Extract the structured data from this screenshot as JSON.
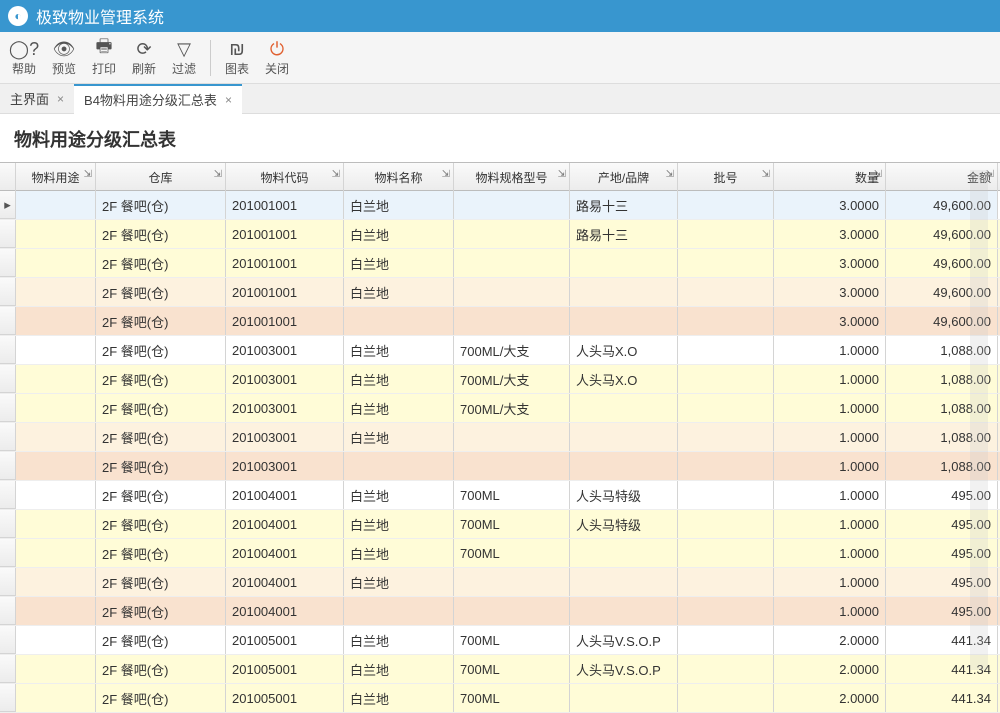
{
  "app": {
    "title": "极致物业管理系统"
  },
  "toolbar": {
    "help": "帮助",
    "preview": "预览",
    "print": "打印",
    "refresh": "刷新",
    "filter": "过滤",
    "chart": "图表",
    "close": "关闭"
  },
  "tabs": [
    {
      "label": "主界面",
      "closable": true,
      "active": false
    },
    {
      "label": "B4物料用途分级汇总表",
      "closable": true,
      "active": true
    }
  ],
  "page": {
    "title": "物料用途分级汇总表"
  },
  "columns": [
    "物料用途",
    "仓库",
    "物料代码",
    "物料名称",
    "物料规格型号",
    "产地/品牌",
    "批号",
    "数量",
    "金额"
  ],
  "rows": [
    {
      "sel": true,
      "use": "",
      "wh": "2F    餐吧(仓)",
      "code": "201001001",
      "name": "白兰地",
      "spec": "",
      "brand": "路易十三",
      "lot": "",
      "qty": "3.0000",
      "amt": "49,600.00",
      "cls": "a"
    },
    {
      "use": "",
      "wh": "2F    餐吧(仓)",
      "code": "201001001",
      "name": "白兰地",
      "spec": "",
      "brand": "路易十三",
      "lot": "",
      "qty": "3.0000",
      "amt": "49,600.00",
      "cls": "b"
    },
    {
      "use": "",
      "wh": "2F    餐吧(仓)",
      "code": "201001001",
      "name": "白兰地",
      "spec": "",
      "brand": "",
      "lot": "",
      "qty": "3.0000",
      "amt": "49,600.00",
      "cls": "b"
    },
    {
      "use": "",
      "wh": "2F    餐吧(仓)",
      "code": "201001001",
      "name": "白兰地",
      "spec": "",
      "brand": "",
      "lot": "",
      "qty": "3.0000",
      "amt": "49,600.00",
      "cls": "c"
    },
    {
      "use": "",
      "wh": "2F    餐吧(仓)",
      "code": "201001001",
      "name": "",
      "spec": "",
      "brand": "",
      "lot": "",
      "qty": "3.0000",
      "amt": "49,600.00",
      "cls": "d"
    },
    {
      "use": "",
      "wh": "2F    餐吧(仓)",
      "code": "201003001",
      "name": "白兰地",
      "spec": "700ML/大支",
      "brand": "人头马X.O",
      "lot": "",
      "qty": "1.0000",
      "amt": "1,088.00",
      "cls": "a"
    },
    {
      "use": "",
      "wh": "2F    餐吧(仓)",
      "code": "201003001",
      "name": "白兰地",
      "spec": "700ML/大支",
      "brand": "人头马X.O",
      "lot": "",
      "qty": "1.0000",
      "amt": "1,088.00",
      "cls": "b"
    },
    {
      "use": "",
      "wh": "2F    餐吧(仓)",
      "code": "201003001",
      "name": "白兰地",
      "spec": "700ML/大支",
      "brand": "",
      "lot": "",
      "qty": "1.0000",
      "amt": "1,088.00",
      "cls": "b"
    },
    {
      "use": "",
      "wh": "2F    餐吧(仓)",
      "code": "201003001",
      "name": "白兰地",
      "spec": "",
      "brand": "",
      "lot": "",
      "qty": "1.0000",
      "amt": "1,088.00",
      "cls": "c"
    },
    {
      "use": "",
      "wh": "2F    餐吧(仓)",
      "code": "201003001",
      "name": "",
      "spec": "",
      "brand": "",
      "lot": "",
      "qty": "1.0000",
      "amt": "1,088.00",
      "cls": "d"
    },
    {
      "use": "",
      "wh": "2F    餐吧(仓)",
      "code": "201004001",
      "name": "白兰地",
      "spec": "700ML",
      "brand": "人头马特级",
      "lot": "",
      "qty": "1.0000",
      "amt": "495.00",
      "cls": "a"
    },
    {
      "use": "",
      "wh": "2F    餐吧(仓)",
      "code": "201004001",
      "name": "白兰地",
      "spec": "700ML",
      "brand": "人头马特级",
      "lot": "",
      "qty": "1.0000",
      "amt": "495.00",
      "cls": "b"
    },
    {
      "use": "",
      "wh": "2F    餐吧(仓)",
      "code": "201004001",
      "name": "白兰地",
      "spec": "700ML",
      "brand": "",
      "lot": "",
      "qty": "1.0000",
      "amt": "495.00",
      "cls": "b"
    },
    {
      "use": "",
      "wh": "2F    餐吧(仓)",
      "code": "201004001",
      "name": "白兰地",
      "spec": "",
      "brand": "",
      "lot": "",
      "qty": "1.0000",
      "amt": "495.00",
      "cls": "c"
    },
    {
      "use": "",
      "wh": "2F    餐吧(仓)",
      "code": "201004001",
      "name": "",
      "spec": "",
      "brand": "",
      "lot": "",
      "qty": "1.0000",
      "amt": "495.00",
      "cls": "d"
    },
    {
      "use": "",
      "wh": "2F    餐吧(仓)",
      "code": "201005001",
      "name": "白兰地",
      "spec": "700ML",
      "brand": "人头马V.S.O.P",
      "lot": "",
      "qty": "2.0000",
      "amt": "441.34",
      "cls": "a"
    },
    {
      "use": "",
      "wh": "2F    餐吧(仓)",
      "code": "201005001",
      "name": "白兰地",
      "spec": "700ML",
      "brand": "人头马V.S.O.P",
      "lot": "",
      "qty": "2.0000",
      "amt": "441.34",
      "cls": "b"
    },
    {
      "use": "",
      "wh": "2F    餐吧(仓)",
      "code": "201005001",
      "name": "白兰地",
      "spec": "700ML",
      "brand": "",
      "lot": "",
      "qty": "2.0000",
      "amt": "441.34",
      "cls": "b"
    }
  ]
}
